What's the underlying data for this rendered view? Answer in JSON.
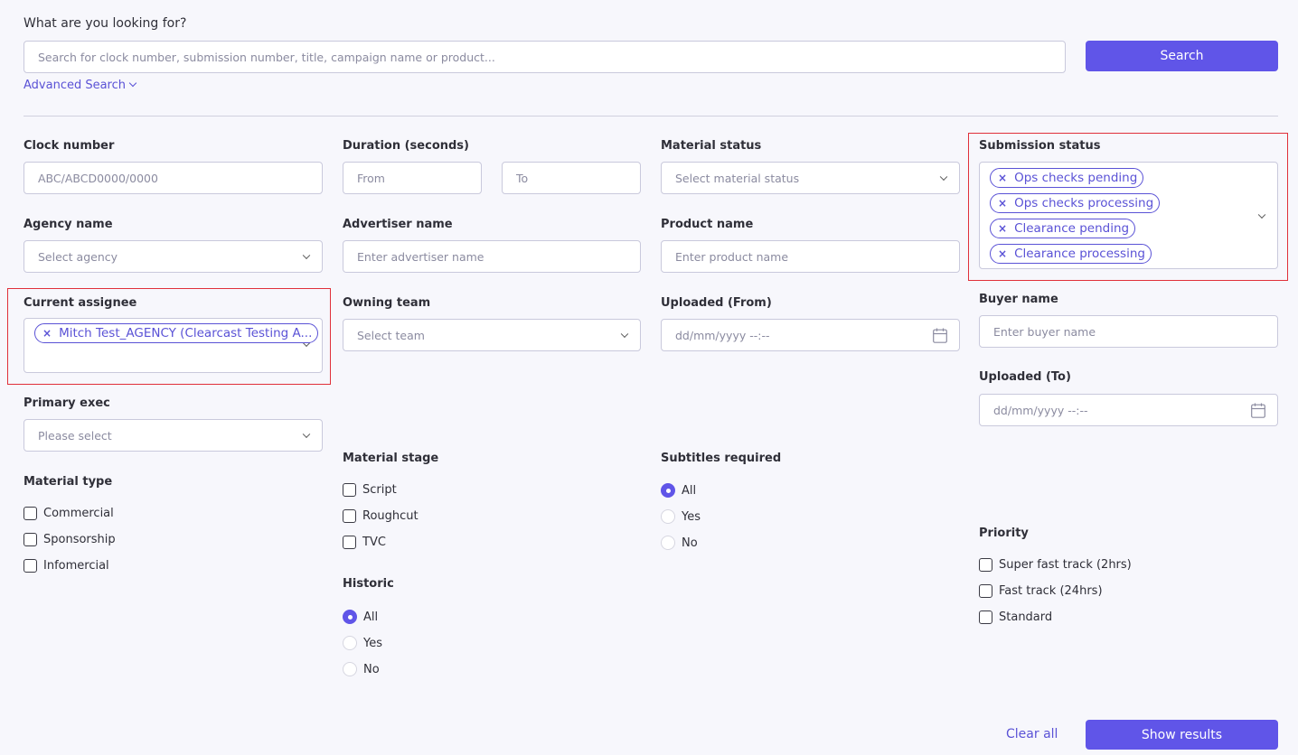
{
  "search": {
    "heading": "What are you looking for?",
    "placeholder": "Search for clock number, submission number, title, campaign name or product...",
    "button": "Search",
    "advanced": "Advanced Search"
  },
  "filters": {
    "clock_number": {
      "label": "Clock number",
      "placeholder": "ABC/ABCD0000/0000"
    },
    "duration": {
      "label": "Duration (seconds)",
      "from_placeholder": "From",
      "to_placeholder": "To"
    },
    "material_status": {
      "label": "Material status",
      "placeholder": "Select material status"
    },
    "submission_status": {
      "label": "Submission status",
      "tags": [
        "Ops checks pending",
        "Ops checks processing",
        "Clearance pending",
        "Clearance processing"
      ]
    },
    "agency_name": {
      "label": "Agency name",
      "placeholder": "Select agency"
    },
    "advertiser_name": {
      "label": "Advertiser name",
      "placeholder": "Enter advertiser name"
    },
    "product_name": {
      "label": "Product name",
      "placeholder": "Enter product name"
    },
    "current_assignee": {
      "label": "Current assignee",
      "tag": "Mitch Test_AGENCY (Clearcast Testing A..."
    },
    "owning_team": {
      "label": "Owning team",
      "placeholder": "Select team"
    },
    "uploaded_from": {
      "label": "Uploaded (From)",
      "placeholder": "dd/mm/yyyy --:--"
    },
    "buyer_name": {
      "label": "Buyer name",
      "placeholder": "Enter buyer name"
    },
    "uploaded_to": {
      "label": "Uploaded (To)",
      "placeholder": "dd/mm/yyyy --:--"
    },
    "primary_exec": {
      "label": "Primary exec",
      "placeholder": "Please select"
    },
    "material_type": {
      "label": "Material type",
      "options": [
        "Commercial",
        "Sponsorship",
        "Infomercial"
      ]
    },
    "material_stage": {
      "label": "Material stage",
      "options": [
        "Script",
        "Roughcut",
        "TVC"
      ]
    },
    "subtitles_required": {
      "label": "Subtitles required",
      "options": [
        "All",
        "Yes",
        "No"
      ],
      "selected": "All"
    },
    "historic": {
      "label": "Historic",
      "options": [
        "All",
        "Yes",
        "No"
      ],
      "selected": "All"
    },
    "priority": {
      "label": "Priority",
      "options": [
        "Super fast track (2hrs)",
        "Fast track (24hrs)",
        "Standard"
      ]
    }
  },
  "footer": {
    "clear_all": "Clear all",
    "show_results": "Show results"
  },
  "colors": {
    "accent": "#6055e8",
    "highlight_border": "#e0303a",
    "background": "#f7f7fc"
  }
}
